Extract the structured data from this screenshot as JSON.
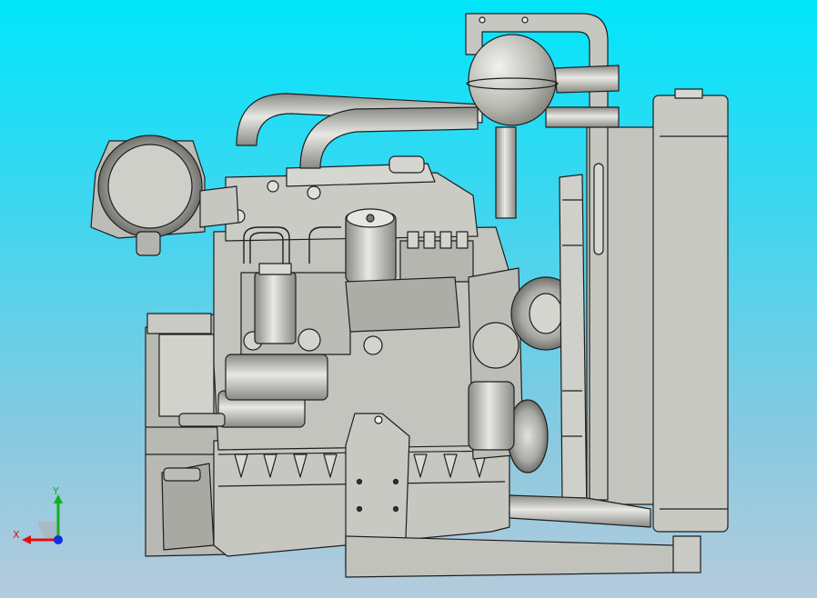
{
  "viewport": {
    "background_top": "#00e6fb",
    "background_bottom": "#b4cbdc",
    "model_fill": "#c2c2bc",
    "model_edge": "#1e1e1e",
    "model_shade": "#8d8d88"
  },
  "triad": {
    "x_label": "X",
    "y_label": "Y",
    "x_color": "#e01010",
    "y_color": "#10b020",
    "z_color": "#1030e0",
    "icons": [
      "coordinate-triad-icon"
    ]
  }
}
